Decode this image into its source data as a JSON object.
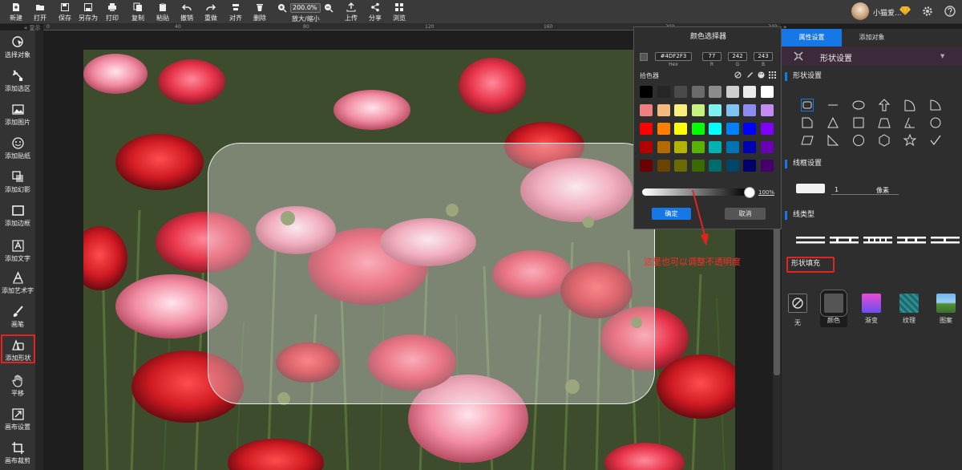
{
  "toolbar": {
    "items": [
      {
        "label": "新建",
        "icon": "new-file-icon"
      },
      {
        "label": "打开",
        "icon": "open-folder-icon"
      },
      {
        "label": "保存",
        "icon": "save-icon"
      },
      {
        "label": "另存为",
        "icon": "save-as-icon"
      },
      {
        "label": "打印",
        "icon": "print-icon"
      },
      {
        "label": "复制",
        "icon": "copy-icon"
      },
      {
        "label": "粘贴",
        "icon": "paste-icon"
      },
      {
        "label": "撤销",
        "icon": "undo-icon"
      },
      {
        "label": "重做",
        "icon": "redo-icon"
      },
      {
        "label": "对齐",
        "icon": "align-icon"
      },
      {
        "label": "删除",
        "icon": "delete-icon"
      }
    ],
    "zoom_value": "200.0%",
    "zoom_label": "放大/缩小",
    "items_right": [
      {
        "label": "上传",
        "icon": "upload-icon"
      },
      {
        "label": "分享",
        "icon": "share-icon"
      },
      {
        "label": "浏览",
        "icon": "browse-icon"
      }
    ],
    "user_name": "小猫爱...",
    "accent": "#1677e6"
  },
  "ruler": {
    "ticks": [
      "0",
      "40",
      "80",
      "120",
      "160",
      "200",
      "240"
    ]
  },
  "left_tools": [
    {
      "label": "选择对象",
      "icon": "select-object-icon"
    },
    {
      "label": "添加选区",
      "icon": "add-selection-icon"
    },
    {
      "label": "添加图片",
      "icon": "add-image-icon"
    },
    {
      "label": "添加贴纸",
      "icon": "add-sticker-icon"
    },
    {
      "label": "添加幻影",
      "icon": "add-phantom-icon"
    },
    {
      "label": "添加边框",
      "icon": "add-border-icon"
    },
    {
      "label": "添加文字",
      "icon": "add-text-icon"
    },
    {
      "label": "添加艺术字",
      "icon": "add-art-text-icon"
    },
    {
      "label": "画笔",
      "icon": "brush-icon"
    },
    {
      "label": "添加形状",
      "icon": "add-shape-icon",
      "selected": true
    },
    {
      "label": "平移",
      "icon": "pan-hand-icon"
    },
    {
      "label": "画布设置",
      "icon": "canvas-settings-icon"
    },
    {
      "label": "画布裁剪",
      "icon": "canvas-crop-icon"
    }
  ],
  "color_picker": {
    "title": "颜色选择器",
    "hex": "#4DF2F3",
    "hex_label": "Hex",
    "r": "77",
    "g": "242",
    "b": "243",
    "r_label": "R",
    "g_label": "G",
    "b_label": "B",
    "eyedropper_label": "拾色器",
    "swatches": [
      [
        "#000000",
        "#262626",
        "#4a4a4a",
        "#6b6b6b",
        "#8c8c8c",
        "#cfcfcf",
        "#ececec",
        "#ffffff"
      ],
      [
        "#f08080",
        "#f4b97f",
        "#f9f07c",
        "#c6f27d",
        "#7df2ef",
        "#7fc3f2",
        "#8c8cf2",
        "#c48cf2"
      ],
      [
        "#ff0000",
        "#ff8000",
        "#ffff00",
        "#00ff00",
        "#00ffff",
        "#0080ff",
        "#0000ff",
        "#8000ff"
      ],
      [
        "#b30000",
        "#b36b00",
        "#b3b300",
        "#58b300",
        "#00b3b3",
        "#0074b3",
        "#0000b3",
        "#6a00b3"
      ],
      [
        "#6b0000",
        "#6b4300",
        "#6b6b00",
        "#3a6b00",
        "#006b6b",
        "#00466b",
        "#00006b",
        "#45006b"
      ]
    ],
    "alpha_percent": "100%",
    "alpha_value": 1.0,
    "ok_label": "确定",
    "cancel_label": "取消"
  },
  "annotation": {
    "text": "这里也可以调整不透明度",
    "color": "#ff2b2b"
  },
  "right_panel": {
    "tabs": [
      "属性设置",
      "添加对象"
    ],
    "active_tab": "属性设置",
    "header_title": "形状设置",
    "section_shape": "形状设置",
    "shapes": [
      "rounded-rect-shape-icon",
      "line-shape-icon",
      "ellipse-shape-icon",
      "arrow-up-shape-icon",
      "arc-shape-icon",
      "quarter-circle-shape-icon",
      "folded-corner-shape-icon",
      "triangle-shape-icon",
      "square-shape-icon",
      "trapezoid-shape-icon",
      "angle-shape-icon",
      "circle-shape-icon",
      "parallelogram-shape-icon",
      "right-triangle-shape-icon",
      "octagon-shape-icon",
      "hexagon-shape-icon",
      "star-shape-icon",
      "checkmark-shape-icon"
    ],
    "section_border": "线框设置",
    "border_width": "1",
    "border_unit": "像素",
    "section_linetype": "线类型",
    "section_fill": "形状填充",
    "fill_types": [
      {
        "label": "无",
        "icon": "no-fill-icon"
      },
      {
        "label": "颜色",
        "icon": "color-fill-icon",
        "selected": true
      },
      {
        "label": "渐变",
        "icon": "gradient-fill-icon"
      },
      {
        "label": "纹理",
        "icon": "texture-fill-icon"
      },
      {
        "label": "图案",
        "icon": "pattern-fill-icon"
      }
    ]
  }
}
